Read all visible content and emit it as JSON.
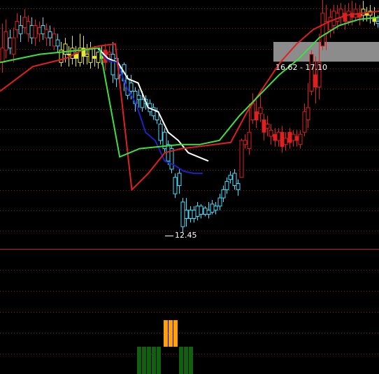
{
  "colors": {
    "background": "#000000",
    "grid": "#7a1f1f",
    "divider": "#b32626",
    "up": "#e02020",
    "down": "#40e0ff",
    "neutral": "#e8e830",
    "ma_white": "#ffffff",
    "ma_blue": "#2020c0",
    "ma_red": "#e02020",
    "ma_green": "#40e040",
    "bar_orange": "#ffa010",
    "bar_green": "#106010",
    "zone": "#8c8c8c"
  },
  "chart_data": {
    "type": "candlestick",
    "y_range": [
      12.2,
      17.9
    ],
    "annotations": {
      "low_label": "12.45",
      "zone_label": "16.62 - 17.10",
      "zone_range": [
        16.62,
        17.1
      ]
    },
    "candles": [
      [
        16.6,
        16.95,
        16.35,
        17.55,
        "up"
      ],
      [
        16.9,
        17.35,
        16.7,
        17.65,
        "up"
      ],
      [
        17.2,
        16.95,
        16.8,
        17.4,
        "down"
      ],
      [
        16.8,
        17.2,
        16.6,
        17.45,
        "up"
      ],
      [
        17.4,
        17.6,
        17.2,
        17.8,
        "up"
      ],
      [
        17.5,
        17.3,
        17.1,
        17.75,
        "down"
      ],
      [
        17.45,
        17.7,
        17.3,
        17.9,
        "up"
      ],
      [
        17.3,
        17.6,
        17.1,
        17.75,
        "up"
      ],
      [
        17.5,
        17.2,
        17.05,
        17.7,
        "down"
      ],
      [
        17.2,
        17.5,
        17.0,
        17.65,
        "up"
      ],
      [
        17.3,
        17.45,
        17.1,
        17.6,
        "up"
      ],
      [
        17.5,
        17.3,
        17.15,
        17.7,
        "down"
      ],
      [
        17.2,
        17.4,
        17.0,
        17.55,
        "up"
      ],
      [
        17.35,
        17.2,
        17.0,
        17.5,
        "down"
      ],
      [
        17.0,
        17.3,
        16.9,
        17.45,
        "up"
      ],
      [
        17.15,
        17.0,
        16.85,
        17.3,
        "down"
      ],
      [
        16.6,
        16.9,
        16.5,
        17.1,
        "neutral"
      ],
      [
        16.8,
        17.05,
        16.6,
        17.2,
        "neutral"
      ],
      [
        16.8,
        16.8,
        16.5,
        17.0,
        "neutral"
      ],
      [
        16.7,
        16.95,
        16.55,
        17.25,
        "neutral"
      ],
      [
        16.8,
        16.7,
        16.5,
        17.0,
        "neutral"
      ],
      [
        16.6,
        16.95,
        16.5,
        17.3,
        "neutral"
      ],
      [
        16.95,
        16.75,
        16.55,
        17.25,
        "neutral"
      ],
      [
        16.75,
        16.8,
        16.55,
        17.05,
        "neutral"
      ],
      [
        16.6,
        16.95,
        16.45,
        17.1,
        "neutral"
      ],
      [
        16.75,
        16.7,
        16.5,
        17.0,
        "neutral"
      ],
      [
        16.6,
        16.85,
        16.45,
        16.95,
        "neutral"
      ],
      [
        16.8,
        16.7,
        16.55,
        17.0,
        "neutral"
      ],
      [
        16.9,
        16.6,
        16.4,
        17.05,
        "up"
      ],
      [
        16.8,
        16.85,
        16.6,
        17.0,
        "up"
      ],
      [
        16.8,
        16.3,
        16.1,
        17.1,
        "down"
      ],
      [
        16.7,
        16.2,
        16.0,
        16.85,
        "down"
      ],
      [
        16.3,
        16.45,
        16.2,
        16.55,
        "down"
      ],
      [
        16.55,
        16.15,
        15.9,
        16.6,
        "down"
      ],
      [
        16.2,
        15.8,
        15.7,
        16.3,
        "down"
      ],
      [
        16.1,
        15.9,
        15.7,
        16.3,
        "down"
      ],
      [
        15.9,
        15.6,
        15.4,
        16.0,
        "down"
      ],
      [
        15.8,
        15.7,
        15.5,
        15.95,
        "down"
      ],
      [
        15.7,
        15.5,
        15.4,
        15.9,
        "down"
      ],
      [
        15.6,
        15.7,
        15.45,
        15.8,
        "down"
      ],
      [
        15.6,
        15.4,
        15.3,
        15.7,
        "down"
      ],
      [
        15.5,
        15.3,
        15.2,
        15.6,
        "down"
      ],
      [
        15.4,
        15.2,
        15.1,
        15.5,
        "down"
      ],
      [
        15.1,
        14.7,
        14.6,
        15.2,
        "down"
      ],
      [
        14.9,
        14.5,
        14.4,
        15.0,
        "down"
      ],
      [
        14.6,
        14.2,
        14.1,
        14.7,
        "down"
      ],
      [
        14.5,
        14.0,
        13.9,
        14.6,
        "down"
      ],
      [
        13.8,
        13.4,
        13.3,
        13.9,
        "down"
      ],
      [
        13.9,
        13.6,
        13.4,
        14.0,
        "down"
      ],
      [
        13.2,
        12.6,
        12.45,
        13.3,
        "down"
      ],
      [
        13.0,
        12.8,
        12.6,
        13.3,
        "down"
      ],
      [
        12.8,
        13.0,
        12.7,
        13.1,
        "down"
      ],
      [
        13.0,
        12.8,
        12.7,
        13.1,
        "down"
      ],
      [
        12.85,
        13.1,
        12.75,
        13.2,
        "down"
      ],
      [
        13.1,
        12.9,
        12.8,
        13.15,
        "down"
      ],
      [
        12.9,
        13.05,
        12.85,
        13.1,
        "down"
      ],
      [
        13.0,
        12.9,
        12.8,
        13.2,
        "down"
      ],
      [
        12.95,
        13.15,
        12.9,
        13.25,
        "down"
      ],
      [
        13.1,
        13.0,
        12.9,
        13.2,
        "down"
      ],
      [
        13.1,
        13.3,
        13.0,
        13.4,
        "down"
      ],
      [
        13.3,
        13.5,
        13.2,
        13.6,
        "down"
      ],
      [
        13.5,
        13.7,
        13.4,
        13.8,
        "down"
      ],
      [
        13.75,
        13.85,
        13.65,
        13.95,
        "down"
      ],
      [
        13.9,
        13.6,
        13.5,
        14.0,
        "down"
      ],
      [
        13.65,
        13.5,
        13.35,
        13.75,
        "down"
      ],
      [
        13.8,
        14.7,
        13.8,
        14.75,
        "up"
      ],
      [
        14.6,
        14.7,
        14.5,
        14.85,
        "up"
      ],
      [
        14.5,
        14.9,
        14.35,
        15.6,
        "up"
      ],
      [
        15.2,
        15.6,
        15.1,
        15.85,
        "up"
      ],
      [
        15.4,
        15.2,
        15.0,
        15.7,
        "up"
      ],
      [
        15.35,
        15.5,
        15.15,
        15.8,
        "up"
      ],
      [
        15.2,
        14.9,
        14.7,
        15.35,
        "up"
      ],
      [
        15.0,
        15.1,
        14.8,
        15.3,
        "up"
      ],
      [
        14.8,
        14.95,
        14.6,
        15.1,
        "up"
      ],
      [
        14.85,
        14.7,
        14.55,
        15.0,
        "up"
      ],
      [
        14.7,
        14.9,
        14.55,
        15.0,
        "up"
      ],
      [
        14.9,
        14.55,
        14.4,
        15.05,
        "up"
      ],
      [
        14.6,
        14.75,
        14.45,
        14.9,
        "up"
      ],
      [
        14.9,
        14.65,
        14.5,
        15.0,
        "up"
      ],
      [
        14.7,
        14.85,
        14.55,
        14.95,
        "up"
      ],
      [
        14.8,
        14.7,
        14.55,
        14.95,
        "up"
      ],
      [
        14.6,
        14.85,
        14.5,
        14.95,
        "up"
      ],
      [
        14.9,
        15.4,
        14.8,
        15.6,
        "up"
      ],
      [
        15.2,
        15.5,
        15.0,
        16.1,
        "up"
      ],
      [
        15.9,
        16.8,
        15.8,
        16.9,
        "up"
      ],
      [
        16.3,
        16.0,
        15.6,
        16.75,
        "up"
      ],
      [
        16.0,
        16.6,
        15.7,
        17.3,
        "up"
      ],
      [
        17.0,
        17.8,
        16.9,
        18.2,
        "up"
      ],
      [
        17.3,
        17.6,
        16.9,
        18.0,
        "up"
      ],
      [
        17.4,
        17.7,
        17.2,
        17.9,
        "up"
      ],
      [
        17.5,
        17.85,
        17.3,
        18.0,
        "up"
      ],
      [
        17.6,
        17.8,
        17.4,
        18.0,
        "up"
      ],
      [
        17.7,
        17.9,
        17.5,
        18.05,
        "up"
      ],
      [
        17.8,
        17.6,
        17.4,
        18.0,
        "up"
      ],
      [
        17.6,
        17.85,
        17.5,
        18.05,
        "up"
      ],
      [
        17.8,
        17.7,
        17.5,
        18.1,
        "up"
      ],
      [
        17.7,
        17.9,
        17.6,
        18.05,
        "up"
      ],
      [
        17.8,
        17.7,
        17.5,
        18.0,
        "up"
      ],
      [
        17.75,
        17.9,
        17.6,
        18.1,
        "neutral"
      ],
      [
        17.8,
        17.75,
        17.6,
        17.95,
        "neutral"
      ],
      [
        17.75,
        17.85,
        17.55,
        18.0,
        "neutral"
      ],
      [
        17.7,
        17.6,
        17.5,
        17.95,
        "neutral"
      ],
      [
        17.6,
        17.55,
        17.45,
        17.75,
        "down"
      ]
    ],
    "ma_white": [
      [
        16.95,
        16.7
      ],
      [
        16.6,
        16.2
      ],
      [
        16.1,
        15.5
      ],
      [
        15.4,
        14.9
      ],
      [
        14.7,
        14.4
      ],
      [
        14.3,
        14.2
      ]
    ],
    "ma_blue": [
      [
        16.9,
        16.65
      ],
      [
        16.6,
        16.0
      ],
      [
        15.6,
        14.9
      ],
      [
        14.7,
        14.2
      ],
      [
        14.1,
        13.95
      ],
      [
        13.9,
        13.9
      ]
    ],
    "ma_red": [
      [
        15.9,
        16.2
      ],
      [
        16.5,
        16.6
      ],
      [
        16.7,
        16.9
      ],
      [
        17.0,
        17.05
      ],
      [
        13.5,
        13.9
      ],
      [
        14.4,
        14.5
      ],
      [
        14.55,
        14.6
      ],
      [
        14.65,
        15.4
      ],
      [
        16.0,
        16.6
      ],
      [
        17.05,
        17.4
      ],
      [
        17.6,
        17.75
      ],
      [
        17.8,
        17.85
      ]
    ],
    "ma_green": [
      [
        16.6,
        16.7
      ],
      [
        16.8,
        16.85
      ],
      [
        16.9,
        16.95
      ],
      [
        14.3,
        14.5
      ],
      [
        14.55,
        14.6
      ],
      [
        14.6,
        14.7
      ],
      [
        15.3,
        15.8
      ],
      [
        16.3,
        16.7
      ],
      [
        17.2,
        17.5
      ],
      [
        17.65,
        17.7
      ]
    ],
    "lower_bars": {
      "orange": [
        [
          234,
          458
        ],
        [
          241,
          458
        ],
        [
          248,
          458
        ]
      ],
      "green": [
        [
          196,
          496
        ],
        [
          203,
          496
        ],
        [
          210,
          496
        ],
        [
          217,
          496
        ],
        [
          224,
          496
        ],
        [
          256,
          496
        ],
        [
          263,
          496
        ],
        [
          270,
          496
        ]
      ]
    }
  }
}
